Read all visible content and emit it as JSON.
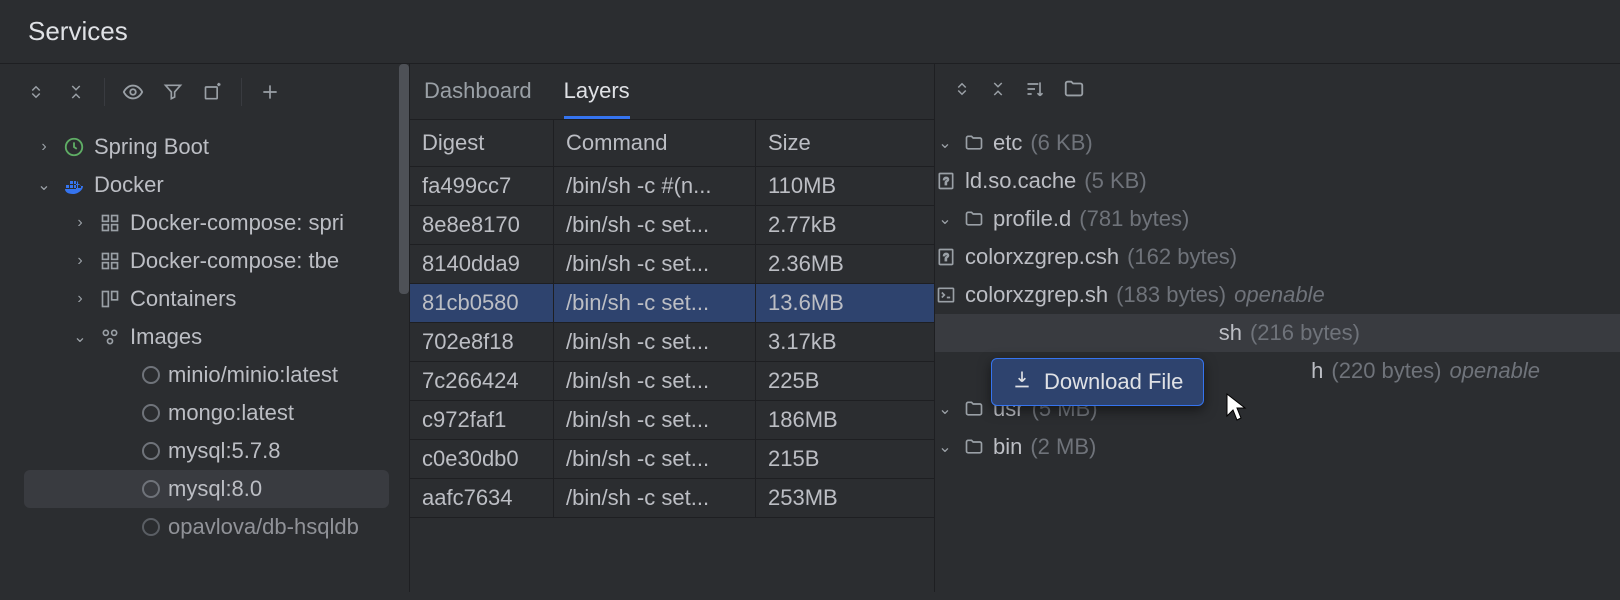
{
  "panel_title": "Services",
  "sidebar": {
    "spring_boot": "Spring Boot",
    "docker": "Docker",
    "compose_spri": "Docker-compose: spri",
    "compose_tbe": "Docker-compose: tbe",
    "containers": "Containers",
    "images": "Images",
    "image_items": [
      "minio/minio:latest",
      "mongo:latest",
      "mysql:5.7.8",
      "mysql:8.0",
      "opavlova/db-hsqldb"
    ]
  },
  "tabs": {
    "dashboard": "Dashboard",
    "layers": "Layers"
  },
  "table": {
    "headers": {
      "digest": "Digest",
      "command": "Command",
      "size": "Size"
    },
    "rows": [
      {
        "digest": "fa499cc7",
        "command": "/bin/sh -c #(n...",
        "size": "110MB"
      },
      {
        "digest": "8e8e8170",
        "command": "/bin/sh -c set...",
        "size": "2.77kB"
      },
      {
        "digest": "8140dda9",
        "command": "/bin/sh -c set...",
        "size": "2.36MB"
      },
      {
        "digest": "81cb0580",
        "command": "/bin/sh -c set...",
        "size": "13.6MB"
      },
      {
        "digest": "702e8f18",
        "command": "/bin/sh -c set...",
        "size": "3.17kB"
      },
      {
        "digest": "7c266424",
        "command": "/bin/sh -c set...",
        "size": "225B"
      },
      {
        "digest": "c972faf1",
        "command": "/bin/sh -c set...",
        "size": "186MB"
      },
      {
        "digest": "c0e30db0",
        "command": "/bin/sh -c set...",
        "size": "215B"
      },
      {
        "digest": "aafc7634",
        "command": "/bin/sh -c set...",
        "size": "253MB"
      }
    ]
  },
  "file_tree": {
    "etc": {
      "name": "etc",
      "size": "(6 KB)"
    },
    "ld_so_cache": {
      "name": "ld.so.cache",
      "size": "(5 KB)"
    },
    "profile_d": {
      "name": "profile.d",
      "size": "(781 bytes)"
    },
    "colorxzgrep_csh": {
      "name": "colorxzgrep.csh",
      "size": "(162 bytes)"
    },
    "colorxzgrep_sh": {
      "name": "colorxzgrep.sh",
      "size": "(183 bytes)",
      "openable": "openable"
    },
    "hidden_sh": {
      "name": "sh",
      "size": "(216 bytes)"
    },
    "hidden_sh2": {
      "name": "h",
      "size": "(220 bytes)",
      "openable": "openable"
    },
    "usr": {
      "name": "usr",
      "size": "(5 MB)"
    },
    "bin": {
      "name": "bin",
      "size": "(2 MB)"
    }
  },
  "popup": {
    "download_file": "Download File"
  }
}
